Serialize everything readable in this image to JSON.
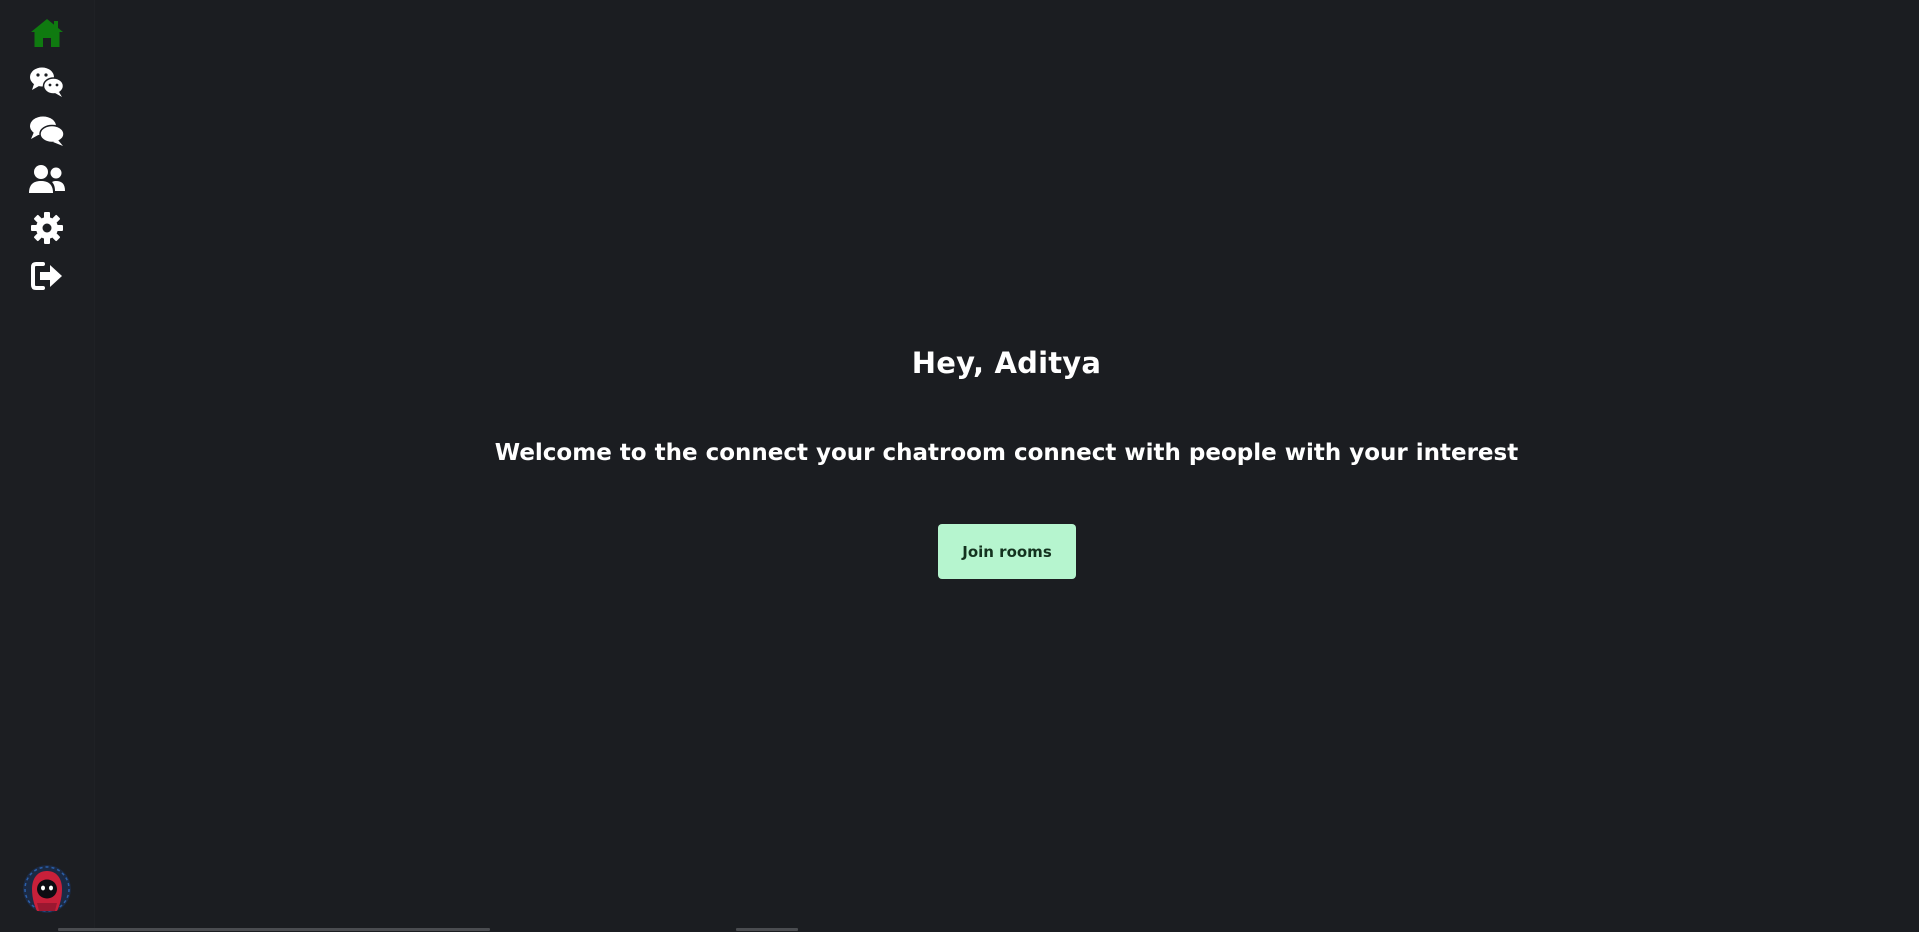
{
  "sidebar": {
    "items": [
      {
        "icon": "home-icon",
        "active": true
      },
      {
        "icon": "wechat-icon",
        "active": false
      },
      {
        "icon": "comments-icon",
        "active": false
      },
      {
        "icon": "users-icon",
        "active": false
      },
      {
        "icon": "gear-icon",
        "active": false
      },
      {
        "icon": "sign-out-icon",
        "active": false
      }
    ],
    "avatar": {
      "icon": "hooded-character-avatar"
    }
  },
  "main": {
    "greeting": "Hey, Aditya",
    "welcome": "Welcome to the connect your chatroom connect with people with your interest",
    "join_button_label": "Join rooms"
  },
  "colors": {
    "background": "#1b1d21",
    "active_icon": "#0f7a10",
    "icon": "#ffffff",
    "button_bg": "#b6f5cf",
    "button_text": "#14321f"
  }
}
